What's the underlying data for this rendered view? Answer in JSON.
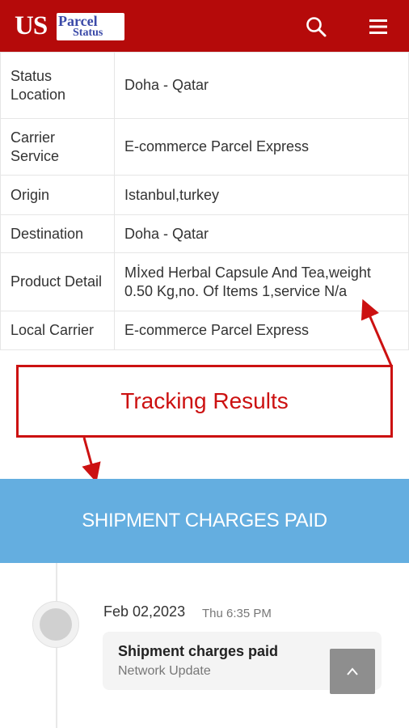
{
  "header": {
    "logo_us": "US",
    "logo_parcel": "Parcel",
    "logo_status": "Status",
    "brand_color": "#b50a0a",
    "search_icon": "search-icon",
    "menu_icon": "hamburger-menu-icon"
  },
  "details": [
    {
      "label_lines": [
        "Status",
        "Location"
      ],
      "value_lines": [
        "Doha - Qatar"
      ]
    },
    {
      "label_lines": [
        "Carrier",
        "Service"
      ],
      "value_lines": [
        "E-commerce Parcel Express"
      ]
    },
    {
      "label_lines": [
        "Origin"
      ],
      "value_lines": [
        "Istanbul,turkey"
      ]
    },
    {
      "label_lines": [
        "Destination"
      ],
      "value_lines": [
        "Doha - Qatar"
      ]
    },
    {
      "label_lines": [
        "Product Detail"
      ],
      "value_lines": [
        "Mİxed Herbal Capsule And Tea,weight",
        "0.50 Kg,no. Of Items 1,service N/a"
      ]
    },
    {
      "label_lines": [
        "Local Carrier"
      ],
      "value_lines": [
        "E-commerce Parcel Express"
      ]
    }
  ],
  "annotation": {
    "text": "Tracking Results",
    "color": "#cc1111"
  },
  "banner": {
    "text": "SHIPMENT CHARGES PAID",
    "color": "#64aee0"
  },
  "timeline": {
    "event": {
      "date": "Feb 02,2023",
      "time": "Thu 6:35 PM",
      "title": "Shipment charges paid",
      "subtitle": "Network Update"
    }
  },
  "scroll_top_icon": "chevron-up-icon"
}
